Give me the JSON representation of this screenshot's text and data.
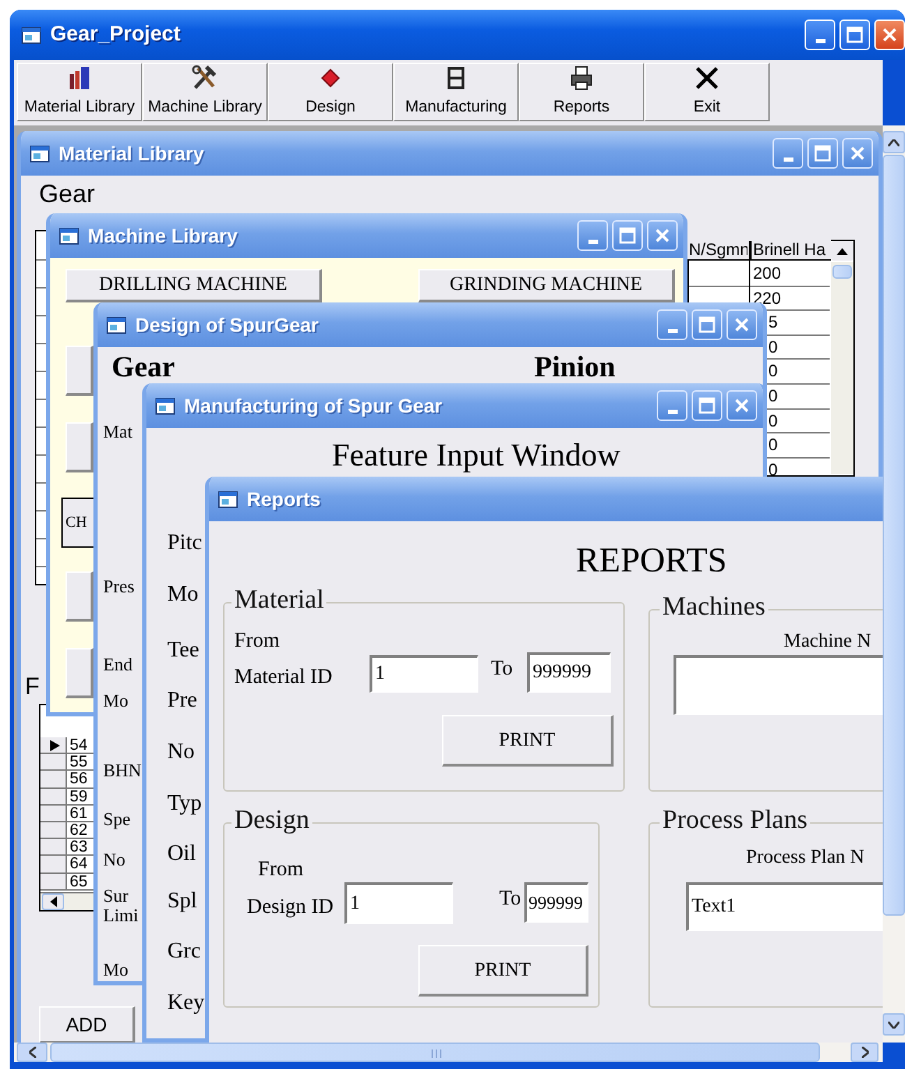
{
  "window": {
    "title": "Gear_Project"
  },
  "toolbar": [
    {
      "label": "Material Library",
      "kind": "books"
    },
    {
      "label": "Machine Library",
      "kind": "tools"
    },
    {
      "label": "Design",
      "kind": "gem"
    },
    {
      "label": "Manufacturing",
      "kind": "cabinet"
    },
    {
      "label": "Reports",
      "kind": "printer"
    },
    {
      "label": "Exit",
      "kind": "cross"
    }
  ],
  "material_library": {
    "title": "Material Library",
    "heading": "Gear",
    "properties_grid": {
      "columns": [
        "N/Sgmn",
        "Brinell Ha"
      ],
      "brinell_values": [
        "200",
        "220",
        "5",
        "0",
        "0",
        "0",
        "0",
        "0",
        "0"
      ]
    },
    "section_heading": "F",
    "materials_grid": {
      "rows": [
        {
          "id": "54",
          "selected": true
        },
        {
          "id": "55",
          "selected": false
        },
        {
          "id": "56",
          "selected": false
        },
        {
          "id": "59",
          "selected": false
        },
        {
          "id": "61",
          "selected": false
        },
        {
          "id": "62",
          "selected": false
        },
        {
          "id": "63",
          "selected": false
        },
        {
          "id": "64",
          "selected": false
        },
        {
          "id": "65",
          "selected": false
        }
      ]
    },
    "add_button": "ADD"
  },
  "machine_library": {
    "title": "Machine Library",
    "buttons": [
      {
        "label": "DRILLING MACHINE"
      },
      {
        "label": "GRINDING MACHINE"
      },
      {
        "label": "CH"
      }
    ]
  },
  "design": {
    "title": "Design of SpurGear",
    "gear_heading": "Gear",
    "pinion_heading": "Pinion",
    "labels": [
      "Mat",
      "Pres",
      "End",
      "Mo",
      "BHN",
      "Spe",
      "No",
      "Sur",
      "Limi",
      "Mo"
    ]
  },
  "manufacturing": {
    "title": "Manufacturing of Spur Gear",
    "heading": "Feature Input Window",
    "labels": [
      "Pitc",
      "Mo",
      "Tee",
      "Pre",
      "No",
      "Typ",
      "Oil",
      "Spl",
      "Grc",
      "Key"
    ]
  },
  "reports": {
    "title": "Reports",
    "heading": "REPORTS",
    "material": {
      "legend": "Material",
      "from_label": "From",
      "id_label": "Material ID",
      "from_value": "1",
      "to_label": "To",
      "to_value": "999999",
      "print_button": "PRINT"
    },
    "machines": {
      "legend": "Machines",
      "field_label": "Machine N"
    },
    "design": {
      "legend": "Design",
      "from_label": "From",
      "id_label": "Design ID",
      "from_value": "1",
      "to_label": "To",
      "to_value": "999999",
      "print_button": "PRINT"
    },
    "process_plans": {
      "legend": "Process Plans",
      "field_label": "Process Plan N",
      "value": "Text1"
    }
  }
}
